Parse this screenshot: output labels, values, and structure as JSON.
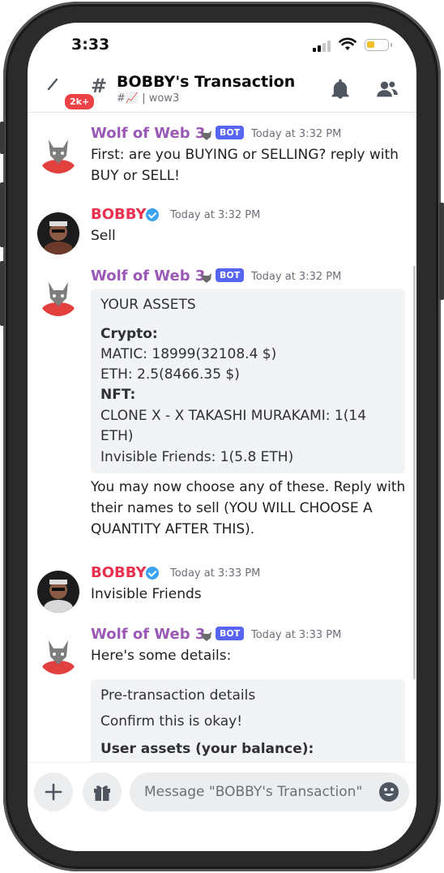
{
  "status": {
    "time": "3:33"
  },
  "header": {
    "badge": "2k+",
    "title": "BOBBY's Transaction",
    "subtitle": "#📈 | wow3"
  },
  "messages": [
    {
      "author": "Wolf of Web 3",
      "bot_tag": "BOT",
      "time": "Today at 3:32 PM",
      "text": [
        "First: are you BUYING or SELLING? reply with",
        "BUY or SELL!"
      ]
    },
    {
      "author": "BOBBY",
      "time": "Today at 3:32 PM",
      "text": [
        "Sell"
      ]
    },
    {
      "author": "Wolf of Web 3",
      "bot_tag": "BOT",
      "time": "Today at 3:32 PM",
      "embed": {
        "title": "YOUR ASSETS",
        "crypto_label": "Crypto:",
        "matic": "MATIC: 18999(32108.4 $)",
        "eth": "ETH: 2.5(8466.35 $)",
        "nft_label": "NFT:",
        "clone_line1": "CLONE X - X TAKASHI MURAKAMI: 1(14",
        "clone_line2": "ETH)",
        "invisible": "Invisible Friends: 1(5.8 ETH)"
      },
      "text": [
        "You may now choose any of these. Reply with",
        "their names to sell (YOU WILL CHOOSE A",
        "QUANTITY AFTER THIS)."
      ]
    },
    {
      "author": "BOBBY",
      "time": "Today at 3:33 PM",
      "text": [
        "Invisible Friends"
      ]
    },
    {
      "author": "Wolf of Web 3",
      "bot_tag": "BOT",
      "time": "Today at 3:33 PM",
      "text": [
        "Here's some details:"
      ],
      "embed": {
        "title": "Pre-transaction details",
        "line1": "Confirm this is okay!",
        "line2": "User assets (your balance):"
      }
    }
  ],
  "composer": {
    "placeholder": "Message \"BOBBY's Transaction\""
  },
  "colors": {
    "wolf": "#9b59b6",
    "bobby": "#e9304e",
    "bot": "#5865f2",
    "verified": "#3ba3f2",
    "badge": "#ed4245"
  },
  "icons": [
    "back-arrow-icon",
    "channel-hash-icon",
    "bell-icon",
    "members-icon",
    "wolf-emoji-icon",
    "verified-check-icon",
    "plus-icon",
    "gift-icon",
    "emoji-icon"
  ]
}
